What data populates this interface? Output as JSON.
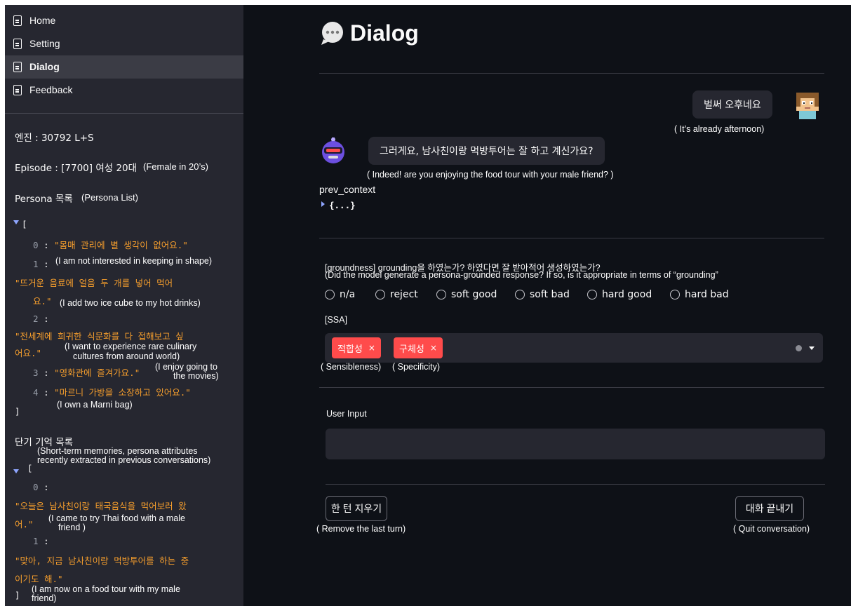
{
  "sidebar": {
    "nav": [
      {
        "label": "Home"
      },
      {
        "label": "Setting"
      },
      {
        "label": "Dialog"
      },
      {
        "label": "Feedback"
      }
    ],
    "engine": "엔진 : 30792 L+S",
    "episode": "Episode : [7700] 여성 20대",
    "episode_note": "(Female in 20’s)",
    "persona_title": "Persona 목록",
    "persona_note": "(Persona List)",
    "persona_items": [
      {
        "index": "0",
        "text": "\"몸매 관리에 별 생각이 없어요.\"",
        "note": "(I am not interested in keeping in shape)"
      },
      {
        "index": "1",
        "text_line1": "\"뜨거운 음료에 얼음 두 개를 넣어 먹어",
        "text_line2": "요.\"",
        "note": "(I add two ice cube to my hot drinks)"
      },
      {
        "index": "2",
        "text_line1": "\"전세계에 희귀한 식문화를 다 접해보고 싶",
        "text_line2": "어요.\"",
        "note_line1": "(I want to experience rare culinary",
        "note_line2": "cultures from around world)"
      },
      {
        "index": "3",
        "text": "\"영화관에 즐겨가요.\"",
        "note_line1": "(I enjoy going to",
        "note_line2": "the movies)"
      },
      {
        "index": "4",
        "text": "\"마르니 가방을 소장하고 있어요.\"",
        "note": "(I own a Marni bag)"
      }
    ],
    "memory_title": "단기 기억 목록",
    "memory_note_line1": "(Short-term memories, persona attributes",
    "memory_note_line2": "recently extracted in previous conversations)",
    "memory_items": [
      {
        "index": "0",
        "text_line1": "\"오늘은 남사친이랑 태국음식을 먹어보러 왔",
        "text_line2": "어.\"",
        "note_line1": "(I came to try Thai food with a male",
        "note_line2": "friend )"
      },
      {
        "index": "1",
        "text_line1": "\"맞아, 지금 남사친이랑 먹방투어를 하는 중",
        "text_line2": "이기도 해.\"",
        "note_line1": "(I am now on a food tour with my male",
        "note_line2": "friend)"
      }
    ],
    "open_bracket": "[",
    "close_bracket": "]",
    "colon": ":"
  },
  "main": {
    "title": "Dialog",
    "user_message": "벌써 오후네요",
    "user_message_note": "( It’s already afternoon)",
    "bot_message": "그러게요, 남사친이랑 먹방투어는 잘 하고 계신가요?",
    "bot_message_note": "( Indeed! are you enjoying the food tour with your male friend? )",
    "prev_context_label": "prev_context",
    "prev_context_value": "{...}",
    "groundness_question": "[groundness] grounding을 하였는가? 하였다면 잘 받아적어 생성하였는가?",
    "groundness_note": "(Did the model generate a persona-grounded response? If so, is it appropriate in terms of “grounding”",
    "groundness_options": [
      "n/a",
      "reject",
      "soft good",
      "soft bad",
      "hard good",
      "hard bad"
    ],
    "ssa_label": "[SSA]",
    "ssa_tags": [
      {
        "label": "적합성",
        "note": "( Sensibleness)"
      },
      {
        "label": "구체성",
        "note": "( Specificity)"
      }
    ],
    "tag_remove": "×",
    "user_input_label": "User Input",
    "user_input_value": "",
    "undo_button": "한 턴 지우기",
    "undo_note": "( Remove the last turn)",
    "quit_button": "대화 끝내기",
    "quit_note": "( Quit conversation)"
  },
  "colors": {
    "sidebar_bg": "#262730",
    "main_bg": "#0e1117",
    "accent": "#ff4b4b",
    "json_string": "#f59e2d"
  }
}
